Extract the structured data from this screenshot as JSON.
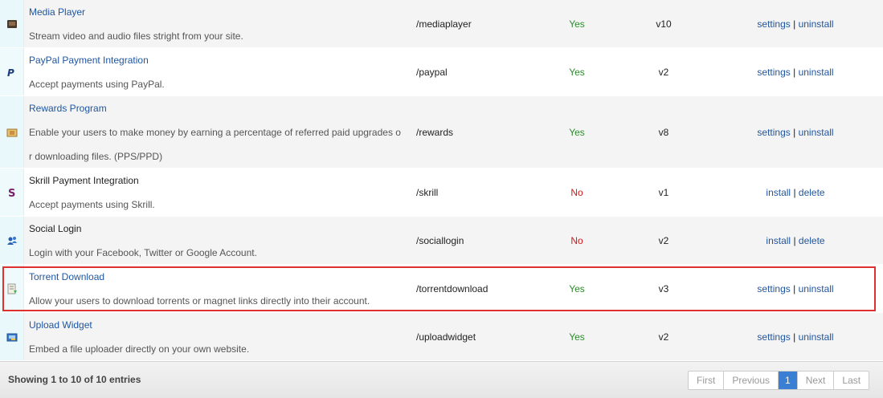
{
  "rows": [
    {
      "name": "Media Player",
      "desc1": "Stream video and audio files stright from your site.",
      "desc2": "",
      "path": "/mediaplayer",
      "active": "Yes",
      "version": "v10",
      "action1": "settings",
      "action2": "uninstall",
      "icon": "media-player-icon"
    },
    {
      "name": "PayPal Payment Integration",
      "desc1": "Accept payments using PayPal.",
      "desc2": "",
      "path": "/paypal",
      "active": "Yes",
      "version": "v2",
      "action1": "settings",
      "action2": "uninstall",
      "icon": "paypal-icon"
    },
    {
      "name": "Rewards Program",
      "desc1": "Enable your users to make money by earning a percentage of referred paid upgrades o",
      "desc2": "r downloading files. (PPS/PPD)",
      "path": "/rewards",
      "active": "Yes",
      "version": "v8",
      "action1": "settings",
      "action2": "uninstall",
      "icon": "rewards-icon"
    },
    {
      "name": "Skrill Payment Integration",
      "desc1": "Accept payments using Skrill.",
      "desc2": "",
      "path": "/skrill",
      "active": "No",
      "version": "v1",
      "action1": "install",
      "action2": "delete",
      "icon": "skrill-icon"
    },
    {
      "name": "Social Login",
      "desc1": "Login with your Facebook, Twitter or Google Account.",
      "desc2": "",
      "path": "/sociallogin",
      "active": "No",
      "version": "v2",
      "action1": "install",
      "action2": "delete",
      "icon": "social-users-icon"
    },
    {
      "name": "Torrent Download",
      "desc1": "Allow your users to download torrents or magnet links directly into their account.",
      "desc2": "",
      "path": "/torrentdownload",
      "active": "Yes",
      "version": "v3",
      "action1": "settings",
      "action2": "uninstall",
      "icon": "torrent-icon"
    },
    {
      "name": "Upload Widget",
      "desc1": "Embed a file uploader directly on your own website.",
      "desc2": "",
      "path": "/uploadwidget",
      "active": "Yes",
      "version": "v2",
      "action1": "settings",
      "action2": "uninstall",
      "icon": "upload-widget-icon"
    }
  ],
  "separator": "|",
  "footer": {
    "showing": "Showing 1 to 10 of 10 entries",
    "first": "First",
    "previous": "Previous",
    "current": "1",
    "next": "Next",
    "last": "Last"
  },
  "colors": {
    "link": "#1f56a0",
    "yes": "#2e8b2e",
    "no": "#cc1a1a",
    "highlight": "#e03131",
    "pager_active": "#3b7fd4"
  }
}
